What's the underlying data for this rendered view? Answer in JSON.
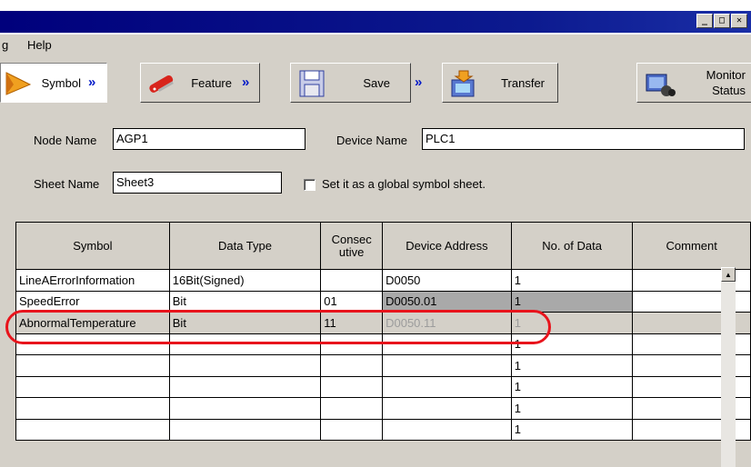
{
  "window": {
    "buttons": {
      "minimize": "_",
      "maximize": "□",
      "close": "✕"
    }
  },
  "menu": {
    "items": [
      "g",
      "Help"
    ]
  },
  "toolbar": {
    "symbol": "Symbol",
    "feature": "Feature",
    "save": "Save",
    "transfer": "Transfer",
    "monitor_line1": "Monitor",
    "monitor_line2": "Status",
    "arrow": "»"
  },
  "form": {
    "node_name_label": "Node Name",
    "node_name_value": "AGP1",
    "device_name_label": "Device Name",
    "device_name_value": "PLC1",
    "sheet_name_label": "Sheet Name",
    "sheet_name_value": "Sheet3",
    "global_label": "Set it as a global symbol sheet.",
    "global_checked": false
  },
  "grid": {
    "columns": [
      "Symbol",
      "Data Type",
      "Consec utive",
      "Device Address",
      "No. of Data",
      "Comment"
    ],
    "column_lines": [
      [
        "Consec",
        "utive"
      ]
    ],
    "rows": [
      {
        "symbol": "LineAErrorInformation",
        "data_type": "16Bit(Signed)",
        "consecutive": "",
        "device_address": "D0050",
        "no_of_data": "1",
        "comment": ""
      },
      {
        "symbol": "SpeedError",
        "data_type": "Bit",
        "consecutive": "01",
        "device_address": "D0050.01",
        "no_of_data": "1",
        "comment": ""
      },
      {
        "symbol": "AbnormalTemperature",
        "data_type": "Bit",
        "consecutive": "11",
        "device_address": "D0050.11",
        "no_of_data": "1",
        "comment": ""
      },
      {
        "symbol": "",
        "data_type": "",
        "consecutive": "",
        "device_address": "",
        "no_of_data": "1",
        "comment": ""
      },
      {
        "symbol": "",
        "data_type": "",
        "consecutive": "",
        "device_address": "",
        "no_of_data": "1",
        "comment": ""
      },
      {
        "symbol": "",
        "data_type": "",
        "consecutive": "",
        "device_address": "",
        "no_of_data": "1",
        "comment": ""
      },
      {
        "symbol": "",
        "data_type": "",
        "consecutive": "",
        "device_address": "",
        "no_of_data": "1",
        "comment": ""
      },
      {
        "symbol": "",
        "data_type": "",
        "consecutive": "",
        "device_address": "",
        "no_of_data": "1",
        "comment": ""
      }
    ],
    "highlight_color": "#e8141c"
  },
  "colors": {
    "title_bar": "#00007c",
    "face": "#d4d0c8",
    "arrow": "#0018c8"
  }
}
